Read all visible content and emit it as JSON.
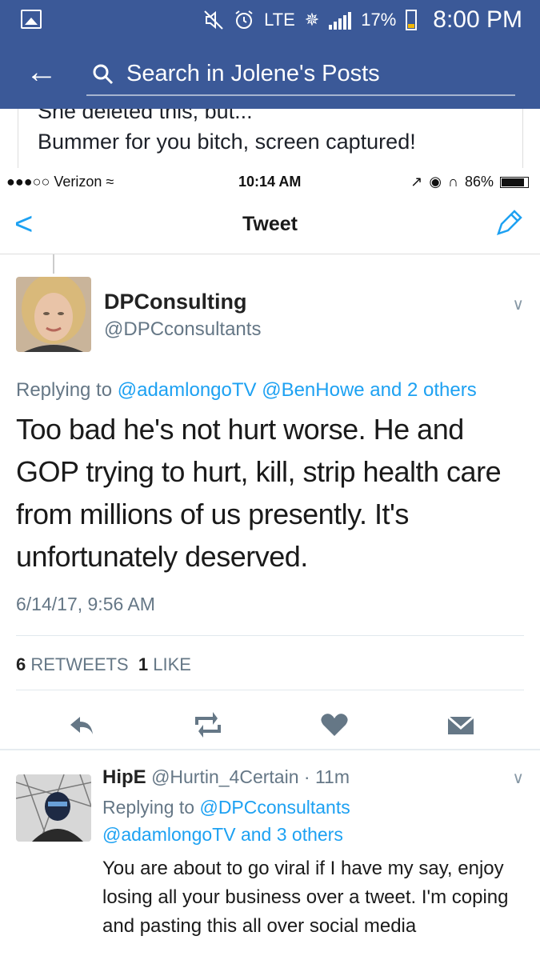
{
  "android_status": {
    "network": "LTE",
    "battery": "17%",
    "time": "8:00 PM"
  },
  "fb_header": {
    "search_placeholder": "Search in Jolene's Posts"
  },
  "post": {
    "line1": "She deleted this, but...",
    "line2": "Bummer for you bitch, screen captured!"
  },
  "ios_status": {
    "carrier": "●●●○○ Verizon ≈",
    "time": "10:14 AM",
    "battery": "86%"
  },
  "tweet_screen": {
    "back": "<",
    "title": "Tweet",
    "tweet": {
      "display_name": "DPConsulting",
      "handle": "@DPCconsultants",
      "replying_prefix": "Replying to",
      "replying_users": "@adamlongoTV @BenHowe and 2 others",
      "text": "Too bad he's not hurt worse. He and GOP trying to hurt, kill, strip health care from millions of us presently. It's unfortunately deserved.",
      "timestamp": "6/14/17, 9:56 AM",
      "retweets_count": "6",
      "retweets_label": "RETWEETS",
      "likes_count": "1",
      "likes_label": "LIKE"
    },
    "reply": {
      "display_name": "HipE",
      "handle": "@Hurtin_4Certain",
      "age": "· 11m",
      "replying_prefix": "Replying to",
      "replying_line1": "@DPCconsultants",
      "replying_line2_users": "@adamlongoTV",
      "replying_line2_and": "and 3 others",
      "text": "You are about to go viral if I have my say, enjoy losing all your business over a tweet. I'm coping and pasting this all over social media"
    }
  },
  "colors": {
    "facebook_blue": "#3b5998",
    "twitter_blue": "#1da1f2",
    "muted_text": "#657786"
  }
}
